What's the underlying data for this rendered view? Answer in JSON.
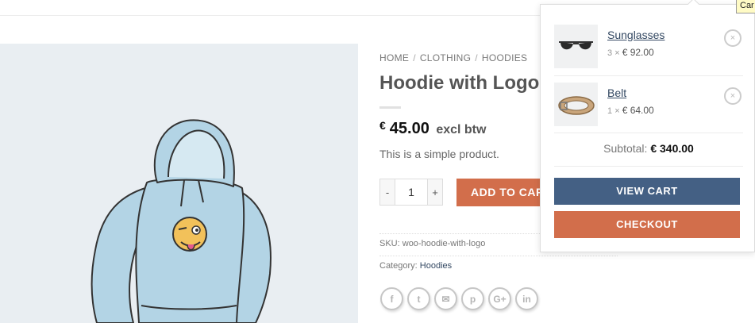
{
  "tooltip": "Car",
  "breadcrumb": [
    "HOME",
    "CLOTHING",
    "HOODIES"
  ],
  "product": {
    "title": "Hoodie with Logo",
    "currency": "€",
    "price": "45.00",
    "price_suffix": "excl btw",
    "short_description": "This is a simple product.",
    "quantity": "1",
    "qty_minus": "-",
    "qty_plus": "+",
    "add_to_cart": "ADD TO CART",
    "sku_label": "SKU:",
    "sku": "woo-hoodie-with-logo",
    "category_label": "Category:",
    "category": "Hoodies"
  },
  "share_icons": [
    "facebook-icon",
    "twitter-icon",
    "email-icon",
    "pinterest-icon",
    "google-plus-icon",
    "linkedin-icon"
  ],
  "share_glyphs": [
    "f",
    "t",
    "✉",
    "p",
    "G+",
    "in"
  ],
  "mini_cart": {
    "items": [
      {
        "name": "Sunglasses",
        "qty": "3",
        "times": "×",
        "price": "€ 92.00"
      },
      {
        "name": "Belt",
        "qty": "1",
        "times": "×",
        "price": "€ 64.00"
      }
    ],
    "remove_glyph": "×",
    "subtotal_label": "Subtotal:",
    "subtotal_value": "€ 340.00",
    "view_cart": "VIEW CART",
    "checkout": "CHECKOUT"
  },
  "colors": {
    "primary": "#446084",
    "accent": "#d26e4b",
    "link": "#334862",
    "image_bg": "#e9eef2"
  }
}
